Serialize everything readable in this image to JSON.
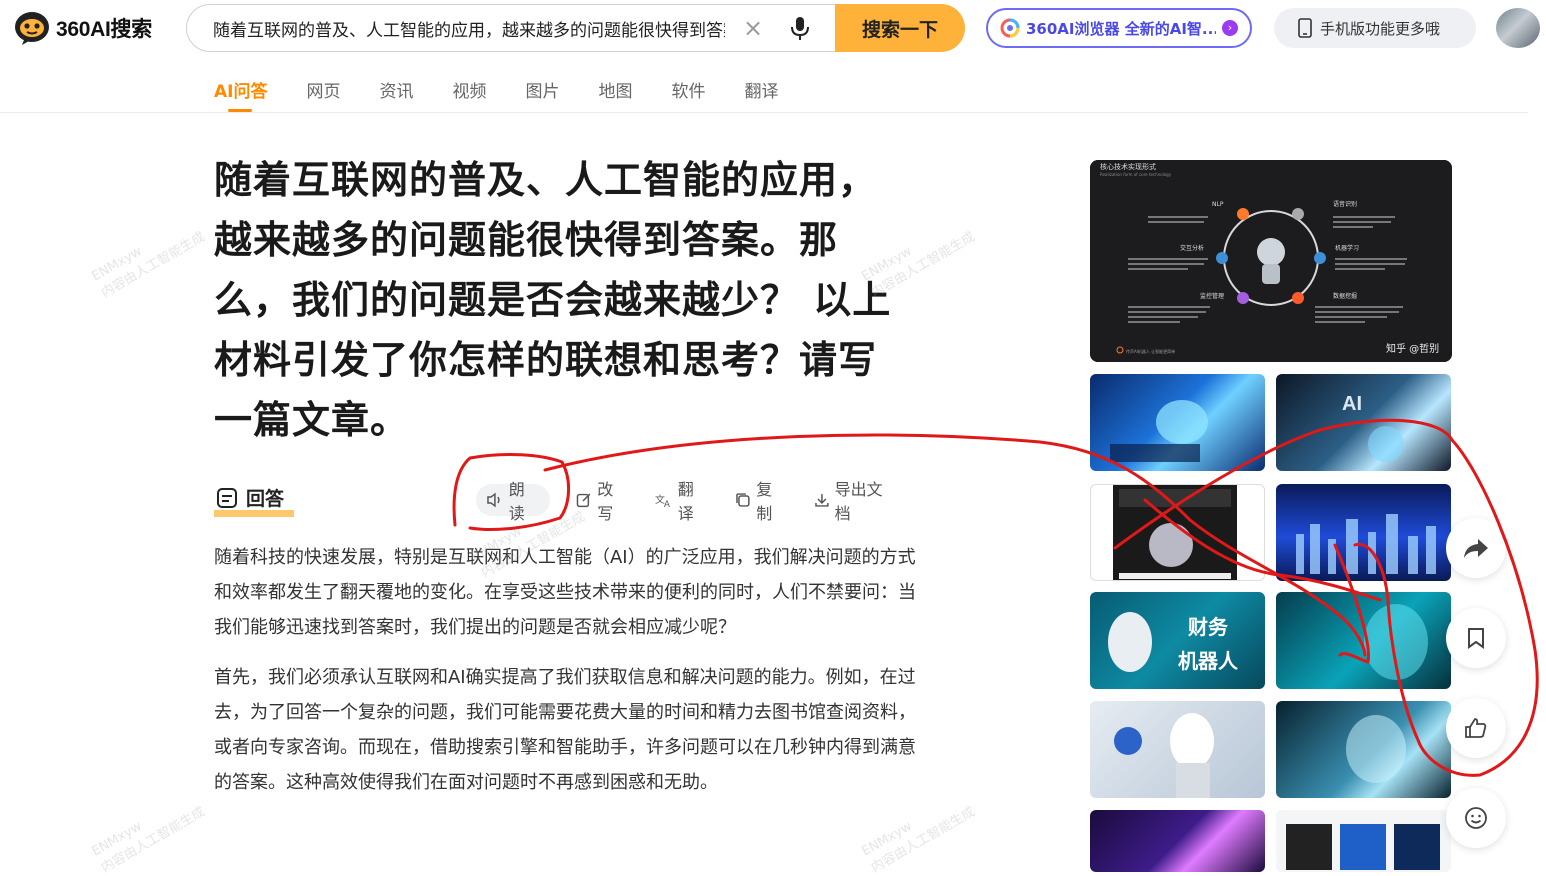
{
  "header": {
    "logo_text": "360AI搜索",
    "search": {
      "value": "随着互联网的普及、人工智能的应用，越来越多的问题能很快得到答案。那么，我们的问题是否会越来越少？ 以上材料引发了你怎样的联想和思考？请写一篇文章。",
      "clear_icon": "close-icon",
      "mic_icon": "microphone-icon"
    },
    "search_button_label": "搜索一下",
    "promo_label": "360AI浏览器 全新的AI智...",
    "mobile_label": "手机版功能更多哦"
  },
  "tabs": [
    {
      "label": "AI问答",
      "active": true
    },
    {
      "label": "网页"
    },
    {
      "label": "资讯"
    },
    {
      "label": "视频"
    },
    {
      "label": "图片"
    },
    {
      "label": "地图"
    },
    {
      "label": "软件"
    },
    {
      "label": "翻译"
    }
  ],
  "question": {
    "title": "随着互联网的普及、人工智能的应用，越来越多的问题能很快得到答案。那么，我们的问题是否会越来越少？ 以上材料引发了你怎样的联想和思考？请写一篇文章。"
  },
  "answer": {
    "heading": "回答",
    "tools": [
      "朗读",
      "改写",
      "翻译",
      "复制",
      "导出文档"
    ],
    "paragraphs": [
      "随着科技的快速发展，特别是互联网和人工智能（AI）的广泛应用，我们解决问题的方式和效率都发生了翻天覆地的变化。在享受这些技术带来的便利的同时，人们不禁要问：当我们能够迅速找到答案时，我们提出的问题是否就会相应减少呢？",
      "首先，我们必须承认互联网和AI确实提高了我们获取信息和解决问题的能力。例如，在过去，为了回答一个复杂的问题，我们可能需要花费大量的时间和精力去图书馆查阅资料，或者向专家咨询。而现在，借助搜索引擎和智能助手，许多问题可以在几秒钟内得到满意的答案。这种高效使得我们在面对问题时不再感到困惑和无助。"
    ]
  },
  "gallery": {
    "featured": {
      "title": "核心技术实现形式",
      "subtitle": "Realization form of core technology",
      "labels": [
        "NLP",
        "语音识别",
        "交互分析",
        "机器学习",
        "监控管理",
        "数据挖掘"
      ],
      "footer_left": "传声AI机器人 让智能更简单",
      "credit": "知乎 @哲别"
    },
    "thumbs": [
      {
        "caption": ""
      },
      {
        "caption": "AI"
      },
      {
        "caption": ""
      },
      {
        "caption": ""
      },
      {
        "caption": "财务 机器人"
      },
      {
        "caption": ""
      },
      {
        "caption": ""
      },
      {
        "caption": ""
      },
      {
        "caption": ""
      },
      {
        "caption": ""
      }
    ]
  },
  "side_actions": [
    "share-icon",
    "bookmark-icon",
    "thumbs-up-icon",
    "feedback-smile-icon"
  ],
  "watermark": {
    "text1": "ENMxyw",
    "text2": "内容由人工智能生成"
  },
  "colors": {
    "accent": "#ff8a00",
    "search_button": "#ffb23a",
    "promo_border": "#6d6bf5",
    "annotation": "#e01818"
  }
}
